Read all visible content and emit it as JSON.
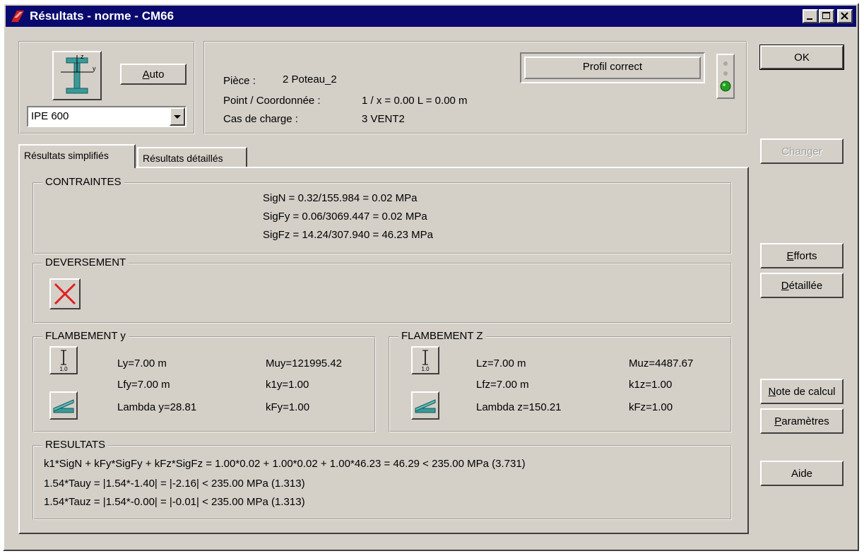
{
  "window": {
    "title": "Résultats - norme - CM66"
  },
  "profile": {
    "auto_label": "Auto",
    "auto_underline": "A",
    "auto_rest": "uto",
    "selected": "IPE 600",
    "axis_z": "z",
    "axis_y": "y"
  },
  "info": {
    "piece_label": "Pièce :",
    "piece_value": "2  Poteau_2",
    "point_label": "Point / Coordonnée :",
    "point_value": "1 / x = 0.00 L = 0.00 m",
    "case_label": "Cas de charge :",
    "case_value": "3 VENT2",
    "status": "Profil correct",
    "status_color": "#20a020"
  },
  "tabs": [
    {
      "label": "Résultats simplifiés"
    },
    {
      "label": "Résultats détaillés"
    }
  ],
  "contraintes": {
    "title": "CONTRAINTES",
    "lines": [
      "SigN = 0.32/155.984 = 0.02 MPa",
      "SigFy = 0.06/3069.447 = 0.02 MPa",
      "SigFz = 14.24/307.940 = 46.23 MPa"
    ]
  },
  "deversement": {
    "title": "DEVERSEMENT",
    "icon": "red-cross-icon"
  },
  "flambement_y": {
    "title": "FLAMBEMENT y",
    "icon_label": "1.0",
    "l": "Ly=7.00 m",
    "lf": "Lfy=7.00 m",
    "lambda": "Lambda y=28.81",
    "mu": "Muy=121995.42",
    "k1": "k1y=1.00",
    "kf": "kFy=1.00"
  },
  "flambement_z": {
    "title": "FLAMBEMENT Z",
    "icon_label": "1.0",
    "l": "Lz=7.00 m",
    "lf": "Lfz=7.00 m",
    "lambda": "Lambda z=150.21",
    "mu": "Muz=4487.67",
    "k1": "k1z=1.00",
    "kf": "kFz=1.00"
  },
  "resultats": {
    "title": "RESULTATS",
    "lines": [
      "k1*SigN + kFy*SigFy + kFz*SigFz = 1.00*0.02 + 1.00*0.02 + 1.00*46.23 =   46.29   < 235.00 MPa  (3.731)",
      "1.54*Tauy = |1.54*-1.40| = |-2.16| < 235.00 MPa   (1.313)",
      "1.54*Tauz = |1.54*-0.00| = |-0.01| < 235.00 MPa   (1.313)"
    ]
  },
  "buttons": {
    "ok": "OK",
    "changer": "Changer",
    "efforts_u": "E",
    "efforts_rest": "fforts",
    "detaillee_u": "D",
    "detaillee_rest": "étaillée",
    "note_u": "N",
    "note_rest": "ote de calcul",
    "parametres_u": "P",
    "parametres_rest": "aramètres",
    "aide": "Aide"
  }
}
